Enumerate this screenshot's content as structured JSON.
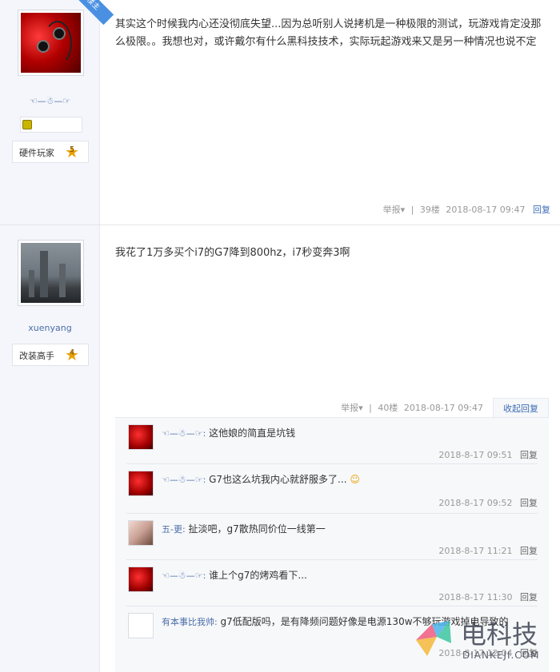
{
  "posts": [
    {
      "author": "☜—☃—☞",
      "is_op_badge": "楼主",
      "rank_label": "硬件玩家",
      "rank_level": "5",
      "content": "其实这个时候我内心还没彻底失望...因为总听别人说拷机是一种极限的测试，玩游戏肯定没那么极限。。我想也对，或许戴尔有什么黑科技技术，实际玩起游戏来又是另一种情况也说不定",
      "report": "举报▾",
      "floor": "39楼",
      "time": "2018-08-17 09:47",
      "reply": "回复"
    },
    {
      "author": "xuenyang",
      "rank_label": "改装高手",
      "rank_level": "4",
      "content": "我花了1万多买个i7的G7降到800hz，i7秒变奔3啊",
      "report": "举报▾",
      "floor": "40楼",
      "time": "2018-08-17 09:47",
      "collapse": "收起回复",
      "comments": [
        {
          "name": "☜—☃—☞:",
          "text": "这他娘的简直是坑钱",
          "time": "2018-8-17 09:51",
          "reply": "回复"
        },
        {
          "name": "☜—☃—☞:",
          "text": "G7也这么坑我内心就舒服多了...",
          "time": "2018-8-17 09:52",
          "reply": "回复"
        },
        {
          "name": "五-更:",
          "text": "扯淡吧，g7散热同价位一线第一",
          "time": "2018-8-17 11:21",
          "reply": "回复"
        },
        {
          "name": "☜—☃—☞:",
          "text": "谁上个g7的烤鸡看下...",
          "time": "2018-8-17 11:30",
          "reply": "回复"
        },
        {
          "name": "有本事比我帅:",
          "text": "g7低配版吗，是有降频问题好像是电源130w不够玩游戏掉电导致的",
          "time": "2018-8-17 12:04",
          "reply": "回复"
        }
      ]
    }
  ],
  "watermark": {
    "text": "电科技",
    "sub": "DIANKEJI.COM"
  }
}
